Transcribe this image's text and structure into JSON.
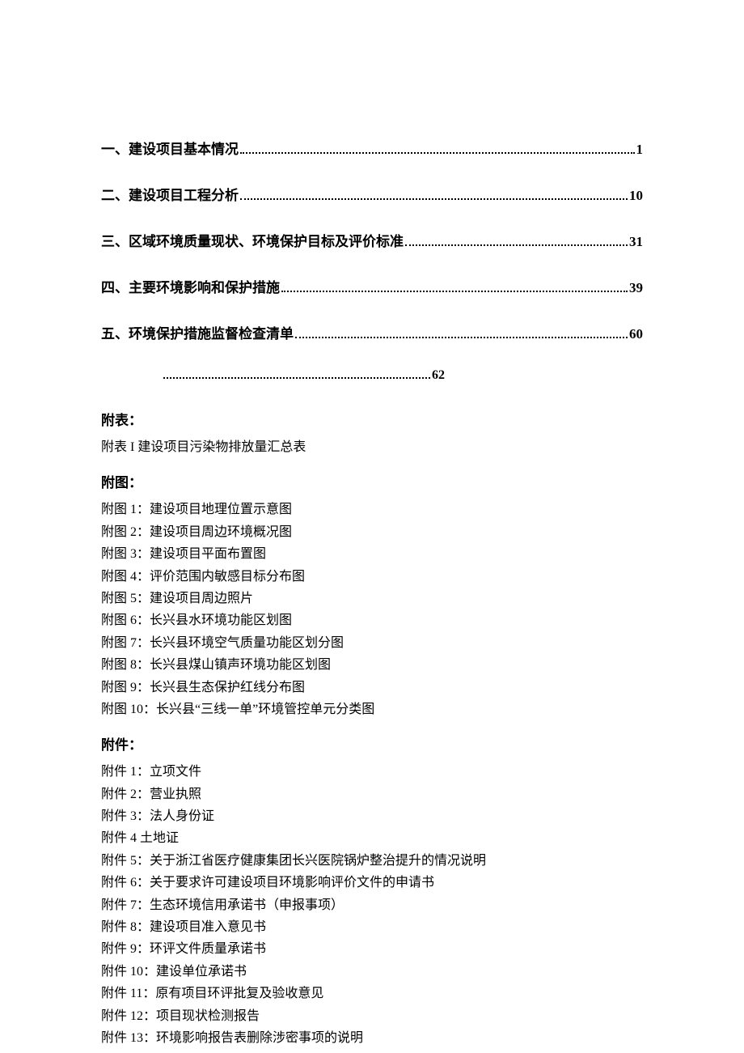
{
  "toc": [
    {
      "title": "一、建设项目基本情况",
      "page": "1"
    },
    {
      "title": "二、建设项目工程分析",
      "page": "10"
    },
    {
      "title": "三、区域环境质量现状、环境保护目标及评价标准",
      "page": "31"
    },
    {
      "title": "四、主要环境影响和保护措施",
      "page": "39"
    },
    {
      "title": "五、环境保护措施监督检查清单",
      "page": "60"
    }
  ],
  "toc_orphan": {
    "page": "62"
  },
  "attach_tables": {
    "heading": "附表：",
    "items": [
      "附表 I 建设项目污染物排放量汇总表"
    ]
  },
  "attach_figures": {
    "heading": "附图：",
    "items": [
      "附图 1：建设项目地理位置示意图",
      "附图 2：建设项目周边环境概况图",
      "附图 3：建设项目平面布置图",
      "附图 4：评价范围内敏感目标分布图",
      "附图 5：建设项目周边照片",
      "附图 6：长兴县水环境功能区划图",
      "附图 7：长兴县环境空气质量功能区划分图",
      "附图 8：长兴县煤山镇声环境功能区划图",
      "附图 9：长兴县生态保护红线分布图",
      "附图 10：长兴县“三线一单”环境管控单元分类图"
    ]
  },
  "attach_files": {
    "heading": "附件：",
    "items": [
      "附件 1：立项文件",
      "附件 2：营业执照",
      "附件 3：法人身份证",
      "附件 4 土地证",
      "附件 5：关于浙江省医疗健康集团长兴医院锅炉整治提升的情况说明",
      "附件 6：关于要求许可建设项目环境影响评价文件的申请书",
      "附件 7：生态环境信用承诺书（申报事项）",
      "附件 8：建设项目准入意见书",
      "附件 9：环评文件质量承诺书",
      "附件 10：建设单位承诺书",
      "附件 11：原有项目环评批复及验收意见",
      "附件 12：项目现状检测报告",
      "附件 13：环境影响报告表删除涉密事项的说明"
    ]
  }
}
